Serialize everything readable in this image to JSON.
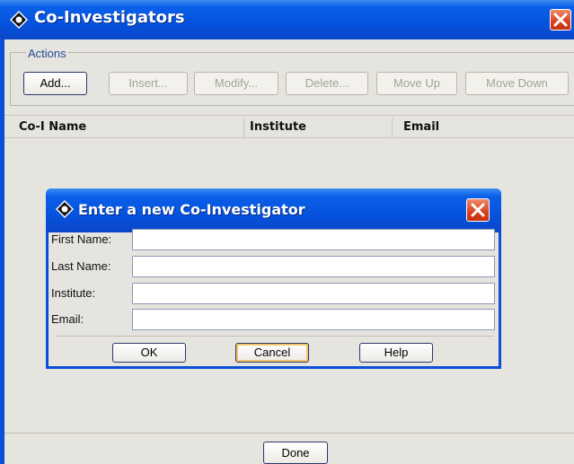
{
  "window": {
    "title": "Co-Investigators",
    "accent": "#0a4fd6",
    "close_icon": "close-icon"
  },
  "actions": {
    "label": "Actions",
    "buttons": [
      {
        "label": "Add...",
        "enabled": true
      },
      {
        "label": "Insert...",
        "enabled": false
      },
      {
        "label": "Modify...",
        "enabled": false
      },
      {
        "label": "Delete...",
        "enabled": false
      },
      {
        "label": "Move Up",
        "enabled": false
      },
      {
        "label": "Move Down",
        "enabled": false
      }
    ]
  },
  "table": {
    "columns": [
      "Co-I Name",
      "Institute",
      "Email"
    ],
    "rows": []
  },
  "footer": {
    "done_label": "Done"
  },
  "dialog": {
    "title": "Enter a new Co-Investigator",
    "fields": [
      {
        "label": "First Name:",
        "value": ""
      },
      {
        "label": "Last Name:",
        "value": ""
      },
      {
        "label": "Institute:",
        "value": ""
      },
      {
        "label": "Email:",
        "value": ""
      }
    ],
    "buttons": {
      "ok": "OK",
      "cancel": "Cancel",
      "help": "Help"
    }
  }
}
